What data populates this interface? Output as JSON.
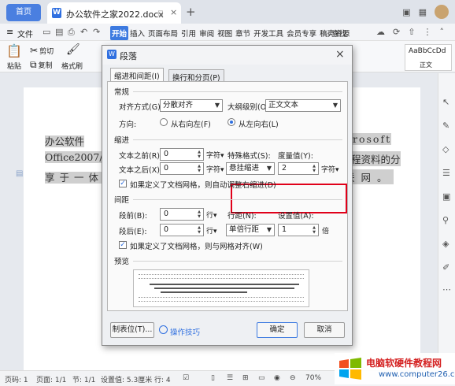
{
  "app": {
    "home_tab": "首页",
    "doc_tab": "办公软件之家2022.docx",
    "tab_dot": "◻",
    "tab_close": "×",
    "new_tab": "+"
  },
  "menubar": {
    "file": "文件",
    "items": [
      "开始",
      "插入",
      "页面布局",
      "引用",
      "审阅",
      "视图",
      "章节",
      "开发工具",
      "会员专享",
      "稿壳资源"
    ],
    "search": "查找"
  },
  "ribbon": {
    "paste": "粘贴",
    "cut": "剪切",
    "copy": "复制",
    "format_painter": "格式刷",
    "style_sample": "AaBbCcDd",
    "style_name": "正文"
  },
  "document": {
    "line1": "办公软件",
    "line2": "Office2007/20",
    "line3": "享于一体",
    "right1": "rosoft",
    "right2": "程资料的分",
    "right3": "联网。"
  },
  "dialog": {
    "title": "段落",
    "tabs": [
      "缩进和间距(I)",
      "换行和分页(P)"
    ],
    "section_general": "常规",
    "align_label": "对齐方式(G):",
    "align_value": "分散对齐",
    "outline_label": "大纲级别(O):",
    "outline_value": "正文文本",
    "direction_label": "方向:",
    "rtl_label": "从右向左(F)",
    "ltr_label": "从左向右(L)",
    "section_indent": "缩进",
    "before_text_label": "文本之前(R):",
    "before_text_value": "0",
    "after_text_label": "文本之后(X):",
    "after_text_value": "0",
    "char_unit": "字符▾",
    "special_label": "特殊格式(S):",
    "special_value": "悬挂缩进",
    "measure_label": "度量值(Y):",
    "measure_value": "2",
    "grid_indent_label": "如果定义了文档网格，则自动调整右缩进(D)",
    "section_spacing": "间距",
    "before_label": "段前(B):",
    "before_value": "0",
    "after_label": "段后(E):",
    "after_value": "0",
    "line_unit": "行▾",
    "line_spacing_label": "行距(N):",
    "line_spacing_value": "单倍行距",
    "set_value_label": "设置值(A):",
    "set_value": "1",
    "times_unit": "倍",
    "grid_align_label": "如果定义了文档网格，则与网格对齐(W)",
    "section_preview": "预览",
    "tabs_button": "制表位(T)...",
    "tips_link": "操作技巧",
    "ok": "确定",
    "cancel": "取消"
  },
  "status": {
    "page_num": "页码: 1",
    "pages": "页面: 1/1",
    "section": "节: 1/1",
    "position": "设置值: 5.3厘米",
    "row": "行: 4",
    "zoom": "70%"
  },
  "watermark": {
    "title": "电脑软硬件教程网",
    "url": "www.computer26.com"
  }
}
